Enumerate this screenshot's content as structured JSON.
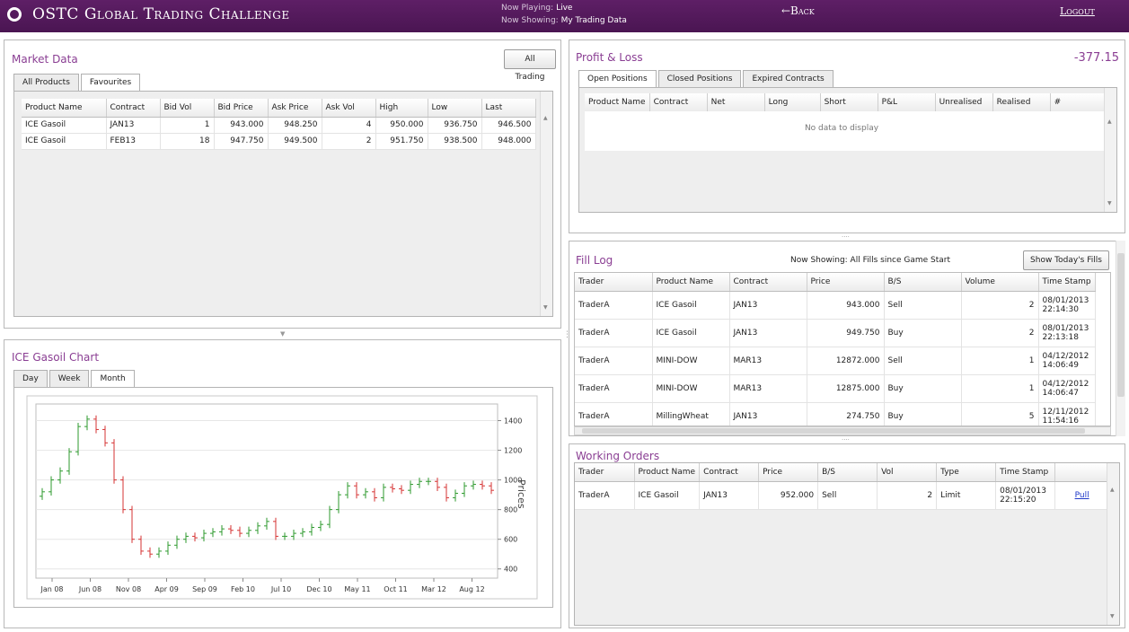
{
  "header": {
    "title": "OSTC Global Trading Challenge",
    "now_playing_label": "Now Playing:",
    "now_playing_value": "Live",
    "now_showing_label": "Now Showing:",
    "now_showing_value": "My Trading Data",
    "back": "←Back",
    "logout": "Logout"
  },
  "market": {
    "title": "Market Data",
    "all_trading": "All Trading",
    "tabs": [
      "All Products",
      "Favourites"
    ],
    "columns": [
      "Product Name",
      "Contract",
      "Bid Vol",
      "Bid Price",
      "Ask Price",
      "Ask Vol",
      "High",
      "Low",
      "Last"
    ],
    "rows": [
      [
        "ICE Gasoil",
        "JAN13",
        "1",
        "943.000",
        "948.250",
        "4",
        "950.000",
        "936.750",
        "946.500"
      ],
      [
        "ICE Gasoil",
        "FEB13",
        "18",
        "947.750",
        "949.500",
        "2",
        "951.750",
        "938.500",
        "948.000"
      ]
    ]
  },
  "chart": {
    "title": "ICE Gasoil Chart",
    "tabs": [
      "Day",
      "Week",
      "Month"
    ]
  },
  "chart_data": {
    "type": "candlestick",
    "ylabel": "Prices",
    "ylim": [
      350,
      1500
    ],
    "y_ticks": [
      400,
      600,
      800,
      1000,
      1200,
      1400
    ],
    "x_tick_labels": [
      "Jan 08",
      "Jun 08",
      "Nov 08",
      "Apr 09",
      "Sep 09",
      "Feb 10",
      "Jul 10",
      "Dec 10",
      "May 11",
      "Oct 11",
      "Mar 12",
      "Aug 12"
    ],
    "up_color": "#2e9a2e",
    "down_color": "#d63333",
    "close": [
      920,
      1000,
      1060,
      1190,
      1360,
      1410,
      1340,
      1250,
      1000,
      800,
      600,
      520,
      500,
      520,
      560,
      600,
      620,
      610,
      640,
      650,
      670,
      660,
      640,
      660,
      690,
      720,
      620,
      620,
      640,
      650,
      680,
      700,
      800,
      900,
      960,
      900,
      920,
      880,
      950,
      940,
      930,
      970,
      990,
      990,
      950,
      880,
      910,
      960,
      970,
      960,
      930
    ]
  },
  "pnl": {
    "title": "Profit & Loss",
    "total": "-377.15",
    "tabs": [
      "Open Positions",
      "Closed Positions",
      "Expired Contracts"
    ],
    "columns": [
      "Product Name",
      "Contract",
      "Net",
      "Long",
      "Short",
      "P&L",
      "Unrealised",
      "Realised",
      "#"
    ],
    "empty": "No data to display"
  },
  "fills": {
    "title": "Fill Log",
    "showing": "Now Showing: All Fills since Game Start",
    "button": "Show Today's Fills",
    "columns": [
      "Trader",
      "Product Name",
      "Contract",
      "Price",
      "B/S",
      "Volume",
      "Time Stamp"
    ],
    "rows": [
      [
        "TraderA",
        "ICE Gasoil",
        "JAN13",
        "943.000",
        "Sell",
        "2",
        "08/01/2013",
        "22:14:30"
      ],
      [
        "TraderA",
        "ICE Gasoil",
        "JAN13",
        "949.750",
        "Buy",
        "2",
        "08/01/2013",
        "22:13:18"
      ],
      [
        "TraderA",
        "MINI-DOW",
        "MAR13",
        "12872.000",
        "Sell",
        "1",
        "04/12/2012",
        "14:06:49"
      ],
      [
        "TraderA",
        "MINI-DOW",
        "MAR13",
        "12875.000",
        "Buy",
        "1",
        "04/12/2012",
        "14:06:47"
      ],
      [
        "TraderA",
        "MillingWheat",
        "JAN13",
        "274.750",
        "Buy",
        "5",
        "12/11/2012",
        "11:54:16"
      ]
    ]
  },
  "orders": {
    "title": "Working Orders",
    "columns": [
      "Trader",
      "Product Name",
      "Contract",
      "Price",
      "B/S",
      "Vol",
      "Type",
      "Time Stamp",
      ""
    ],
    "rows": [
      [
        "TraderA",
        "ICE Gasoil",
        "JAN13",
        "952.000",
        "Sell",
        "2",
        "Limit",
        "08/01/2013",
        "22:15:20",
        "Pull"
      ]
    ]
  }
}
